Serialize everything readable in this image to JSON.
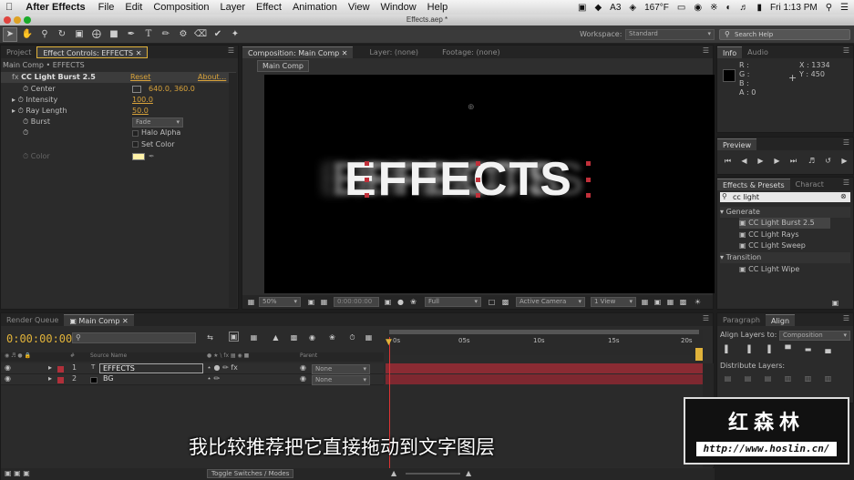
{
  "menubar": {
    "app_name": "After Effects",
    "items": [
      "File",
      "Edit",
      "Composition",
      "Layer",
      "Effect",
      "Animation",
      "View",
      "Window",
      "Help"
    ],
    "status": {
      "badge": "3",
      "temp": "167°F",
      "clock": "Fri 1:13 PM"
    }
  },
  "titlebar": {
    "title": "Effects.aep *"
  },
  "toolbar": {
    "workspace_label": "Workspace:",
    "workspace_value": "Standard",
    "search_placeholder": "Search Help"
  },
  "left_panel": {
    "tabs": [
      "Project",
      "Effect Controls: EFFECTS"
    ],
    "breadcrumb": "Main Comp • EFFECTS",
    "effect_name": "CC Light Burst 2.5",
    "reset": "Reset",
    "about": "About...",
    "props": [
      {
        "name": "Center",
        "value": "640.0, 360.0"
      },
      {
        "name": "Intensity",
        "value": "100.0"
      },
      {
        "name": "Ray Length",
        "value": "50.0"
      },
      {
        "name": "Burst",
        "value": "Fade"
      }
    ],
    "halo_alpha": "Halo Alpha",
    "set_color": "Set Color",
    "color_label": "Color",
    "color_swatch": "#fff2a8"
  },
  "comp_panel": {
    "tab": "Composition: Main Comp",
    "layer_tab": "Layer: (none)",
    "footage_tab": "Footage: (none)",
    "breadcrumb": "Main Comp",
    "canvas_text": "EFFECTS",
    "zoom": "50%",
    "timecode": "0:00:00:00",
    "resolution": "Full",
    "camera": "Active Camera",
    "views": "1 View"
  },
  "info_panel": {
    "tabs": [
      "Info",
      "Audio"
    ],
    "r": "R :",
    "g": "G :",
    "b": "B :",
    "a": "A : 0",
    "x": "X : 1334",
    "y": "Y : 450"
  },
  "preview_panel": {
    "tab": "Preview"
  },
  "effects_panel": {
    "tabs": [
      "Effects & Presets",
      "Charact"
    ],
    "search": "cc light",
    "groups": [
      {
        "name": "Generate",
        "items": [
          "CC Light Burst 2.5",
          "CC Light Rays",
          "CC Light Sweep"
        ]
      },
      {
        "name": "Transition",
        "items": [
          "CC Light Wipe"
        ]
      }
    ]
  },
  "align_panel": {
    "tabs": [
      "Paragraph",
      "Align"
    ],
    "align_layers_label": "Align Layers to:",
    "align_target": "Composition",
    "distribute_label": "Distribute Layers:"
  },
  "timeline": {
    "tabs": [
      "Render Queue",
      "Main Comp"
    ],
    "timecode": "0:00:00:00",
    "search_placeholder": "",
    "columns": {
      "num": "#",
      "source": "Source Name",
      "parent": "Parent"
    },
    "layers": [
      {
        "num": "1",
        "name": "EFFECTS",
        "type": "T",
        "parent": "None",
        "color": "#b0303a"
      },
      {
        "num": "2",
        "name": "BG",
        "type": "",
        "parent": "None",
        "color": "#b0303a"
      }
    ],
    "ruler": [
      "0s",
      "05s",
      "10s",
      "15s",
      "20s"
    ],
    "toggle_label": "Toggle Switches / Modes"
  },
  "overlay": {
    "subtitle": "我比较推荐把它直接拖动到文字图层",
    "logo_cn": "红森林",
    "logo_url": "http://www.hoslin.cn/"
  }
}
